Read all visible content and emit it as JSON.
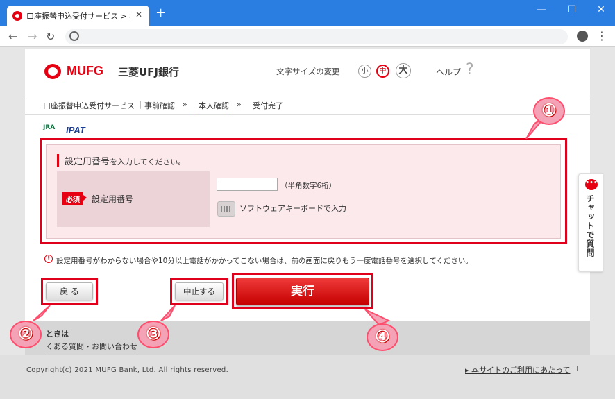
{
  "browser": {
    "tab_title": "口座振替申込受付サービス > 本人確認",
    "tab_close": "✕",
    "new_tab": "+",
    "win_min": "—",
    "win_max": "☐",
    "win_close": "✕",
    "nav_back": "←",
    "nav_forward": "→",
    "nav_reload": "↻",
    "menu": "⋮"
  },
  "header": {
    "logo_text": "MUFG",
    "bank_name": "三菱UFJ銀行",
    "textsize_label": "文字サイズの変更",
    "size_small": "小",
    "size_medium": "中",
    "size_large": "大",
    "help": "ヘルプ",
    "help_icon": "?"
  },
  "breadcrumb": {
    "service": "口座振替申込受付サービス",
    "separator": "|",
    "step1": "事前確認",
    "arrow": "»",
    "step2": "本人確認",
    "step3": "受付完了"
  },
  "ipat": {
    "jra": "JRA",
    "name": "IPAT"
  },
  "form": {
    "title_main": "設定用番号",
    "title_rest": "を入力してください。",
    "required_badge": "必須",
    "field_label": "設定用番号",
    "input_value": "",
    "hint": "（半角数字6桁）",
    "keyboard_link": "ソフトウェアキーボードで入力"
  },
  "notice": {
    "icon": "!",
    "text": "設定用番号がわからない場合や10分以上電話がかかってこない場合は、前の画面に戻りもう一度電話番号を選択してください。"
  },
  "buttons": {
    "back": "戻 る",
    "cancel": "中止する",
    "execute": "実行"
  },
  "help_section": {
    "heading": "ときは",
    "faq_link": "くある質問・お問い合わせ"
  },
  "footer": {
    "copyright": "Copyright(c) 2021 MUFG Bank, Ltd. All rights reserved.",
    "terms_link": "▸ 本サイトのご利用にあたって"
  },
  "chat": {
    "icon": "•••",
    "label": "チャットで質問"
  },
  "annotations": {
    "c1": "①",
    "c2": "②",
    "c3": "③",
    "c4": "④"
  },
  "colors": {
    "brand_red": "#e60012",
    "browser_blue": "#2a7de1",
    "panel_pink": "#fbe9ec"
  }
}
